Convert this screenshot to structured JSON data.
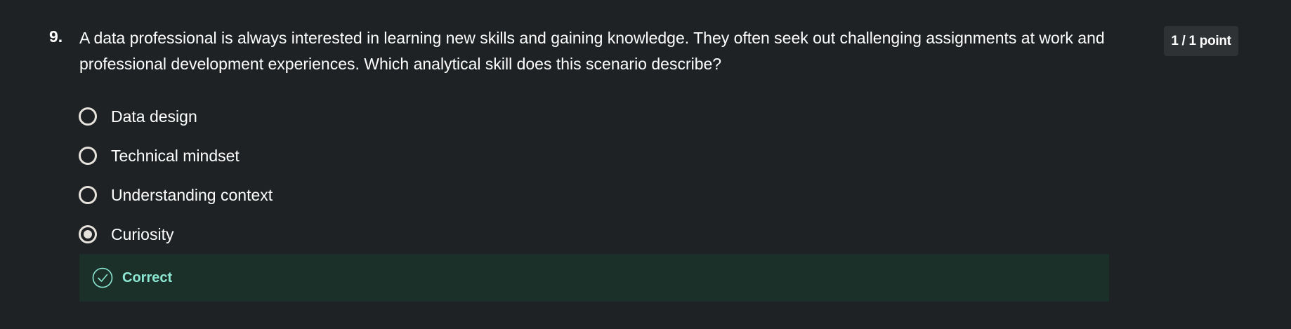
{
  "question": {
    "number": "9.",
    "text": "A data professional is always interested in learning new skills and gaining knowledge. They often seek out challenging assignments at work and professional development experiences. Which analytical skill does this scenario describe?",
    "points": "1 / 1 point"
  },
  "options": [
    {
      "label": "Data design",
      "selected": false
    },
    {
      "label": "Technical mindset",
      "selected": false
    },
    {
      "label": "Understanding context",
      "selected": false
    },
    {
      "label": "Curiosity",
      "selected": true
    }
  ],
  "feedback": {
    "label": "Correct",
    "icon": "check-circle-icon"
  },
  "colors": {
    "background": "#1f2224",
    "badge_background": "#2e3235",
    "radio_border": "#e6e2dc",
    "feedback_background": "#1b3029",
    "feedback_accent": "#8be8d3"
  }
}
